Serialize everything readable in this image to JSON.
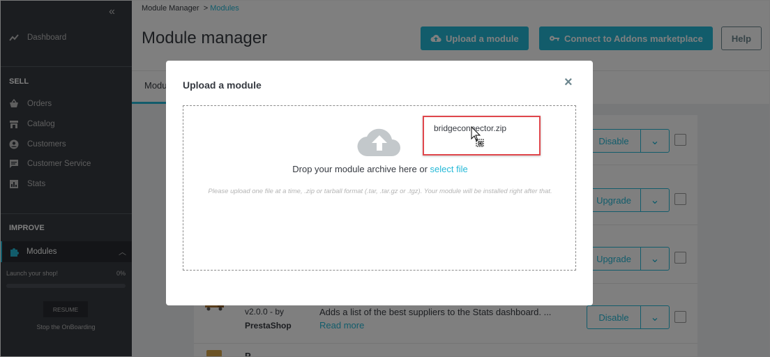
{
  "sidebar": {
    "collapse_icon": "double-chevron-left-icon",
    "dashboard": "Dashboard",
    "sell_title": "SELL",
    "sell_items": [
      "Orders",
      "Catalog",
      "Customers",
      "Customer Service",
      "Stats"
    ],
    "improve_title": "IMPROVE",
    "modules": "Modules",
    "launch_label": "Launch your shop!",
    "launch_percent": "0%",
    "progress_fraction": 0,
    "resume": "RESUME",
    "stop": "Stop the OnBoarding"
  },
  "header": {
    "breadcrumb_parent": "Module Manager",
    "breadcrumb_sep": ">",
    "breadcrumb_current": "Modules",
    "title": "Module manager",
    "upload_button": "Upload a module",
    "connect_button": "Connect to Addons marketplace",
    "help_button": "Help"
  },
  "tabs": {
    "active": "Modu"
  },
  "list": {
    "row_buttons": [
      "Disable",
      "Upgrade",
      "Upgrade",
      "Disable"
    ],
    "visible_module": {
      "version": "v2.0.0 - by",
      "author": "PrestaShop",
      "description": "Adds a list of the best suppliers to the Stats dashboard. ...",
      "read_more": "Read more"
    },
    "next_module_name": "P"
  },
  "modal": {
    "title": "Upload a module",
    "close": "×",
    "drop_text": "Drop your module archive here or",
    "select_file": "select file",
    "hint": "Please upload one file at a time, .zip or tarball format (.tar, .tar.gz or .tgz). Your module will be installed right after that."
  },
  "drag": {
    "file_name": "bridgeconnector.zip",
    "highlight_color": "#e0474c"
  },
  "colors": {
    "accent": "#25b9d7",
    "sidebar_bg": "#363a41"
  }
}
